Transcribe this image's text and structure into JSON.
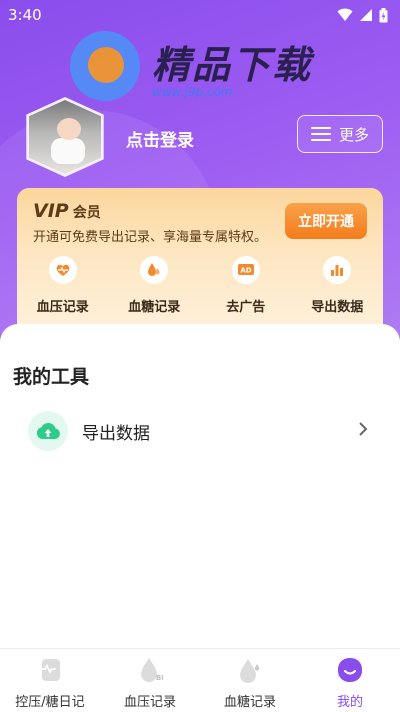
{
  "status_bar": {
    "time": "3:40"
  },
  "watermark": {
    "title": "精品下载",
    "url": "www.j9p.com"
  },
  "header": {
    "login_label": "点击登录",
    "more_label": "更多"
  },
  "vip": {
    "logo": "VIP",
    "title": "会员",
    "description": "开通可免费导出记录、享海量专属特权。",
    "open_button": "立即开通",
    "items": [
      {
        "label": "血压记录",
        "icon": "heart-pulse-icon"
      },
      {
        "label": "血糖记录",
        "icon": "blood-drop-icon"
      },
      {
        "label": "去广告",
        "icon": "ad-icon"
      },
      {
        "label": "导出数据",
        "icon": "bar-chart-icon"
      }
    ]
  },
  "tools": {
    "title": "我的工具",
    "items": [
      {
        "label": "导出数据",
        "icon": "cloud-upload-icon"
      }
    ]
  },
  "tabs": [
    {
      "label": "控压/糖日记",
      "icon": "diary-icon",
      "active": false
    },
    {
      "label": "血压记录",
      "icon": "bp-drop-icon",
      "active": false
    },
    {
      "label": "血糖记录",
      "icon": "sugar-drop-icon",
      "active": false
    },
    {
      "label": "我的",
      "icon": "profile-icon",
      "active": true
    }
  ],
  "colors": {
    "accent": "#8a4dec",
    "vip_orange": "#f47c1b",
    "tool_green": "#2ecc8a"
  }
}
